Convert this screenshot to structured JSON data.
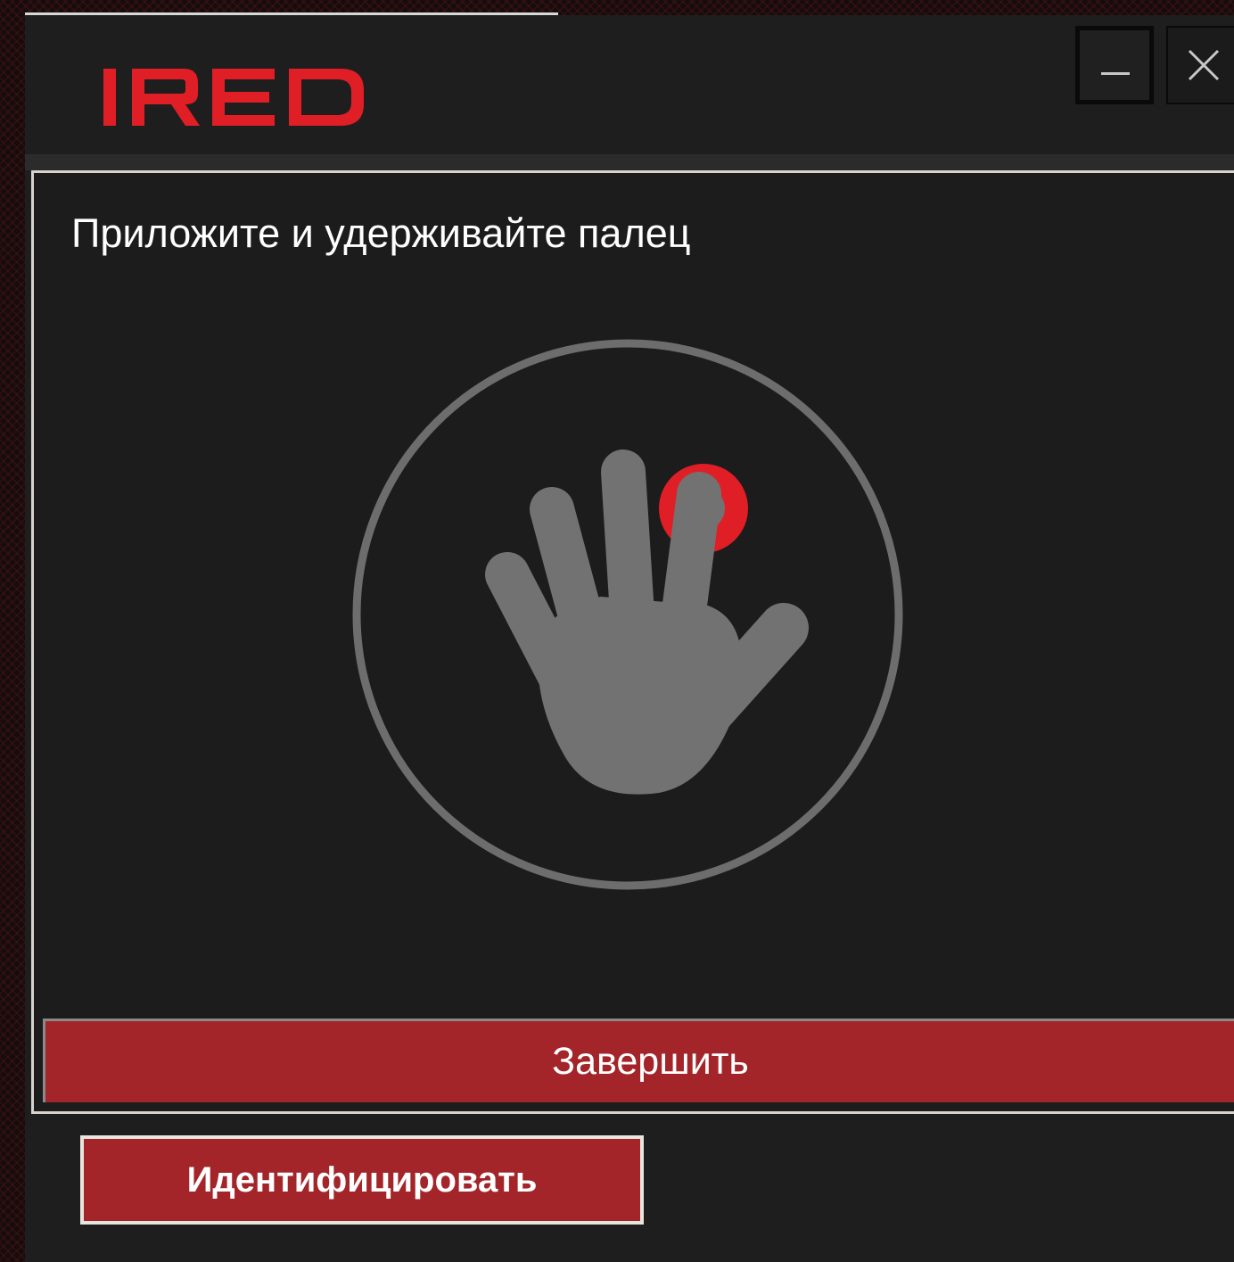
{
  "app": {
    "logo_text": "IRED",
    "brand_color": "#e01e25",
    "button_color": "#a32529",
    "background_color": "#1e1e1f"
  },
  "window_controls": {
    "minimize_icon": "minimize-icon",
    "close_icon": "close-icon"
  },
  "scanner": {
    "instruction": "Приложите и удерживайте палец",
    "icon": "hand-icon",
    "highlight_icon": "fingertip-marker-icon",
    "finish_label": "Завершить"
  },
  "footer": {
    "identify_label": "Идентифицировать"
  }
}
